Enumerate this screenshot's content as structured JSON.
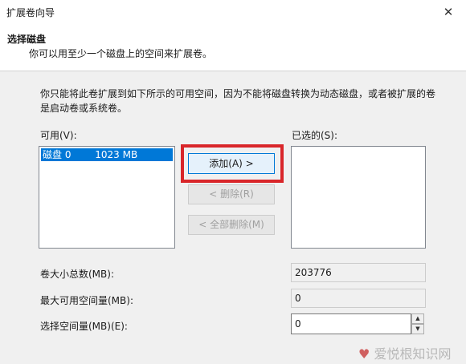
{
  "window": {
    "title": "扩展卷向导"
  },
  "header": {
    "title": "选择磁盘",
    "subtitle": "你可以用至少一个磁盘上的空间来扩展卷。"
  },
  "description": "你只能将此卷扩展到如下所示的可用空间，因为不能将磁盘转换为动态磁盘，或者被扩展的卷是启动卷或系统卷。",
  "available": {
    "label": "可用(V):",
    "items": [
      {
        "name": "磁盘 0",
        "size": "1023 MB",
        "selected": true
      }
    ]
  },
  "selected": {
    "label": "已选的(S):",
    "items": []
  },
  "buttons": {
    "add": "添加(A) >",
    "remove": "< 删除(R)",
    "remove_all": "< 全部删除(M)"
  },
  "fields": {
    "total_size": {
      "label": "卷大小总数(MB):",
      "value": "203776"
    },
    "max_available": {
      "label": "最大可用空间量(MB):",
      "value": "0"
    },
    "select_amount": {
      "label": "选择空间量(MB)(E):",
      "value": "0"
    }
  },
  "watermark": {
    "text": "爱悦根知识网"
  },
  "colors": {
    "selection": "#0078d7",
    "highlight_border": "#d9262a"
  }
}
